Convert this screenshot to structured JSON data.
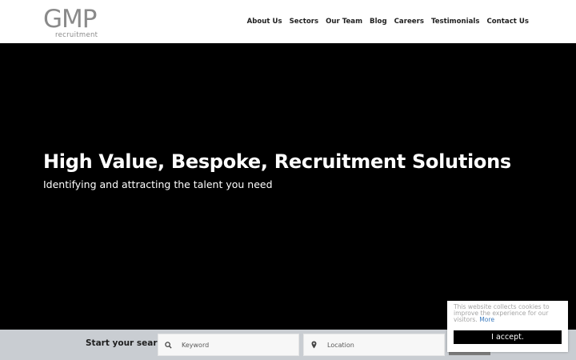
{
  "header": {
    "logo_main": "GMP",
    "logo_sub": "recruitment",
    "nav": [
      {
        "label": "About Us"
      },
      {
        "label": "Sectors"
      },
      {
        "label": "Our Team"
      },
      {
        "label": "Blog"
      },
      {
        "label": "Careers"
      },
      {
        "label": "Testimonials"
      },
      {
        "label": "Contact Us"
      }
    ]
  },
  "hero": {
    "title": "High Value, Bespoke, Recruitment Solutions",
    "subtitle": "Identifying and attracting the talent you need"
  },
  "search": {
    "label": "Start your search",
    "keyword_placeholder": "Keyword",
    "location_placeholder": "Location"
  },
  "cookie": {
    "text": "This website collects cookies to improve the experience for our visitors.",
    "more_label": "More",
    "accept_label": "I accept."
  },
  "colors": {
    "logo": "#8a8a8a",
    "hero_bg": "#000000",
    "search_bar_bg": "#c9cdd2",
    "cookie_link": "#3b7bbf"
  },
  "icons": {
    "keyword": "search-icon",
    "location": "map-pin-icon"
  }
}
